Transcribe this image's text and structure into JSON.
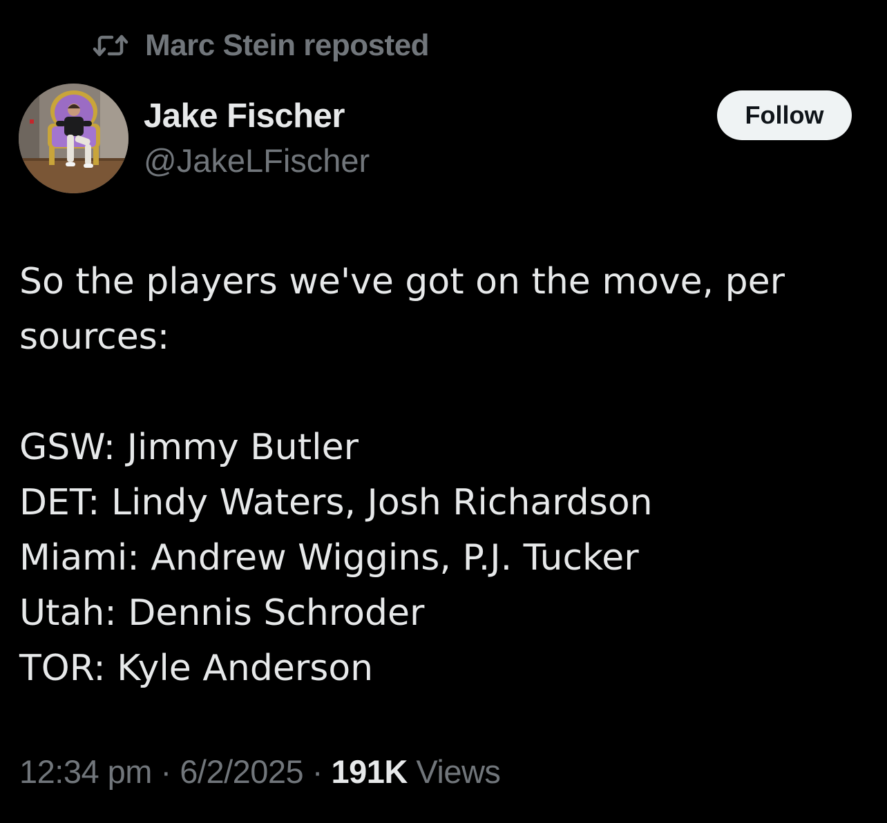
{
  "repost": {
    "text": "Marc Stein reposted",
    "icon": "repost-icon"
  },
  "author": {
    "name": "Jake Fischer",
    "handle": "@JakeLFischer",
    "avatar_icon": "profile-photo"
  },
  "follow_button": {
    "label": "Follow"
  },
  "tweet": {
    "lines": [
      "So the players we've got on the move, per",
      "sources:",
      "",
      "GSW: Jimmy Butler",
      "DET: Lindy Waters, Josh Richardson",
      "Miami: Andrew Wiggins, P.J. Tucker",
      "Utah: Dennis Schroder",
      "TOR: Kyle Anderson"
    ]
  },
  "meta": {
    "time": "12:34 pm",
    "separator": "·",
    "date": "6/2/2025",
    "views_count": "191K",
    "views_label": "Views"
  },
  "colors": {
    "background": "#000000",
    "primary_text": "#e7e9ea",
    "secondary_text": "#71767b",
    "follow_bg": "#eff3f4",
    "follow_text": "#0f1419"
  }
}
